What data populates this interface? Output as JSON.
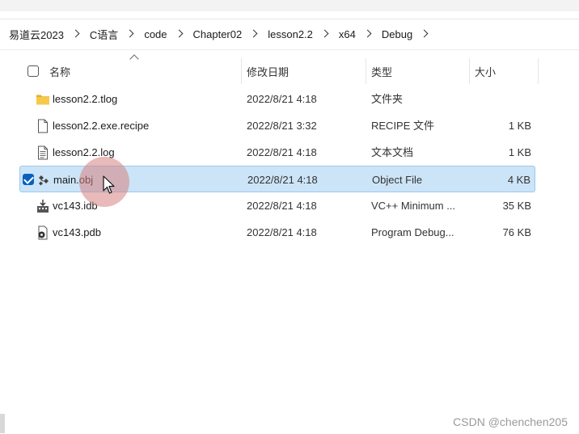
{
  "breadcrumb": {
    "items": [
      "易道云2023",
      "C语言",
      "code",
      "Chapter02",
      "lesson2.2",
      "x64",
      "Debug"
    ]
  },
  "columns": {
    "name": "名称",
    "modified": "修改日期",
    "type": "类型",
    "size": "大小"
  },
  "files": [
    {
      "name": "lesson2.2.tlog",
      "date": "2022/8/21 4:18",
      "type": "文件夹",
      "size": "",
      "icon": "folder-icon"
    },
    {
      "name": "lesson2.2.exe.recipe",
      "date": "2022/8/21 3:32",
      "type": "RECIPE 文件",
      "size": "1 KB",
      "icon": "file-icon"
    },
    {
      "name": "lesson2.2.log",
      "date": "2022/8/21 4:18",
      "type": "文本文档",
      "size": "1 KB",
      "icon": "text-file-icon"
    },
    {
      "name": "main.obj",
      "date": "2022/8/21 4:18",
      "type": "Object File",
      "size": "4 KB",
      "icon": "object-file-icon",
      "selected": true
    },
    {
      "name": "vc143.idb",
      "date": "2022/8/21 4:18",
      "type": "VC++ Minimum ...",
      "size": "35 KB",
      "icon": "idb-file-icon"
    },
    {
      "name": "vc143.pdb",
      "date": "2022/8/21 4:18",
      "type": "Program Debug...",
      "size": "76 KB",
      "icon": "pdb-file-icon"
    }
  ],
  "watermark": "CSDN @chenchen205",
  "colors": {
    "selection": "#cce4f7",
    "selection_border": "#99c9ef",
    "checkbox": "#0b5fbd",
    "folder": "#f2c14e"
  }
}
